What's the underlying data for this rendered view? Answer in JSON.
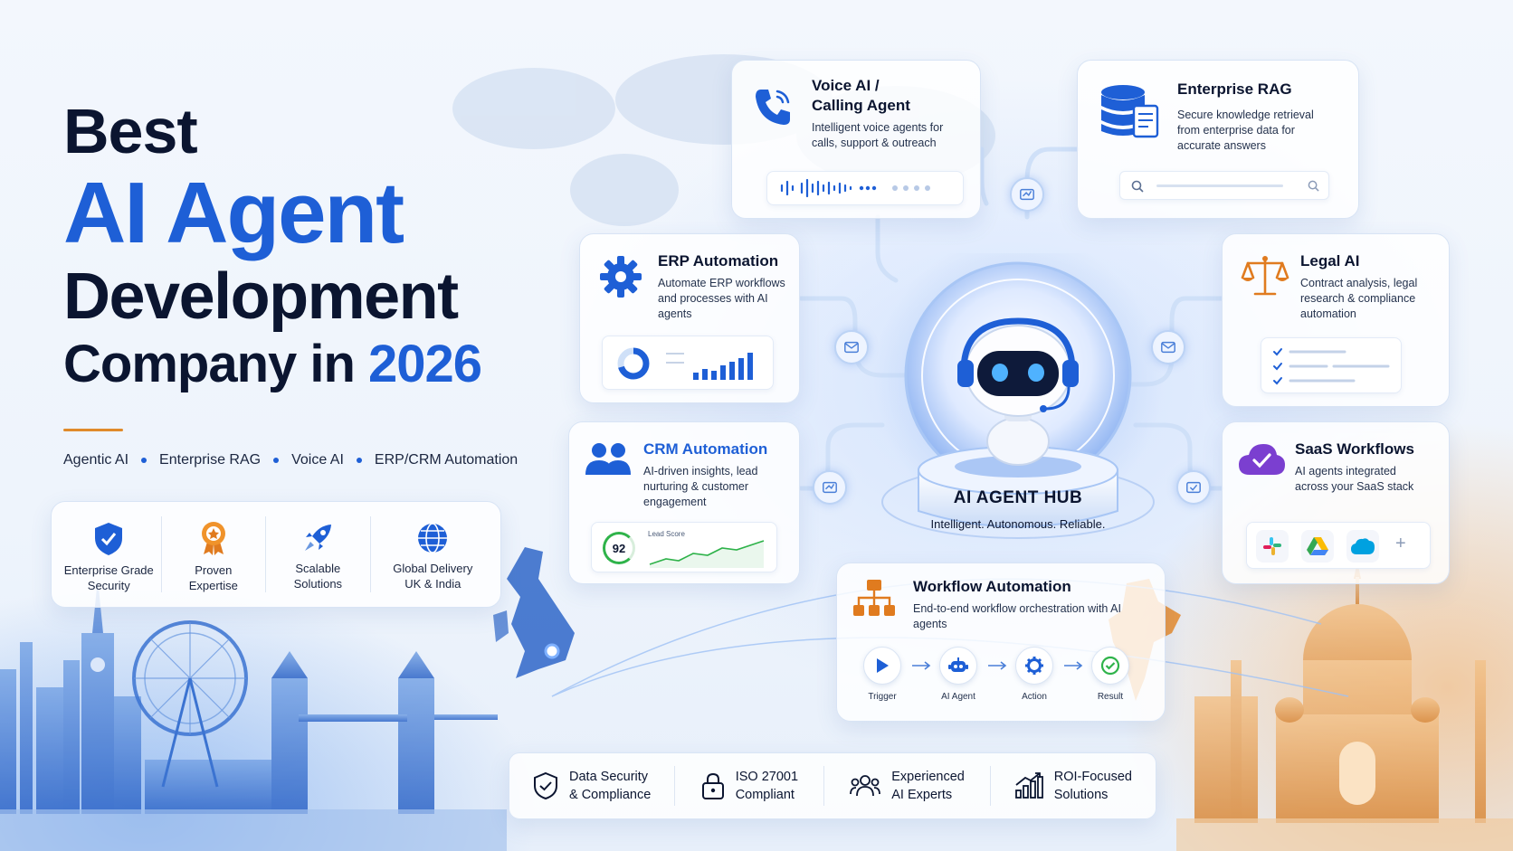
{
  "hero": {
    "line1": "Best",
    "line2": "AI Agent",
    "line3": "Development",
    "line4a": "Company in ",
    "line4b": "2026"
  },
  "tags": [
    "Agentic AI",
    "Enterprise RAG",
    "Voice AI",
    "ERP/CRM Automation"
  ],
  "features": [
    {
      "icon": "shield-check-icon",
      "l1": "Enterprise Grade",
      "l2": "Security"
    },
    {
      "icon": "award-medal-icon",
      "l1": "Proven",
      "l2": "Expertise"
    },
    {
      "icon": "rocket-icon",
      "l1": "Scalable",
      "l2": "Solutions"
    },
    {
      "icon": "globe-icon",
      "l1": "Global Delivery",
      "l2": "UK & India"
    }
  ],
  "hub": {
    "title": "AI AGENT HUB",
    "subtitle": "Intelligent. Autonomous. Reliable."
  },
  "cards": {
    "voice": {
      "title1": "Voice AI /",
      "title2": "Calling Agent",
      "text": "Intelligent voice agents for calls, support & outreach"
    },
    "rag": {
      "title": "Enterprise RAG",
      "text": "Secure knowledge retrieval from enterprise data for accurate answers"
    },
    "erp": {
      "title": "ERP Automation",
      "text": "Automate ERP workflows and processes with AI agents"
    },
    "legal": {
      "title": "Legal AI",
      "text": "Contract analysis, legal research & compliance automation"
    },
    "crm": {
      "title": "CRM Automation",
      "text": "AI-driven insights, lead nurturing & customer engagement",
      "score": "92",
      "score_label": "Lead Score"
    },
    "saas": {
      "title": "SaaS Workflows",
      "text": "AI agents integrated across your SaaS stack",
      "plus": "+"
    },
    "workflow": {
      "title": "Workflow Automation",
      "text": "End-to-end workflow orchestration with AI agents",
      "steps": [
        "Trigger",
        "AI Agent",
        "Action",
        "Result"
      ]
    }
  },
  "bottom": [
    {
      "icon": "shield-check-icon",
      "l1": "Data Security",
      "l2": "& Compliance"
    },
    {
      "icon": "lock-icon",
      "l1": "ISO 27001",
      "l2": "Compliant"
    },
    {
      "icon": "users-icon",
      "l1": "Experienced",
      "l2": "AI Experts"
    },
    {
      "icon": "growth-chart-icon",
      "l1": "ROI-Focused",
      "l2": "Solutions"
    }
  ],
  "colors": {
    "brand_blue": "#1e5fd6",
    "navy": "#0b1530",
    "orange": "#e07b1f"
  }
}
